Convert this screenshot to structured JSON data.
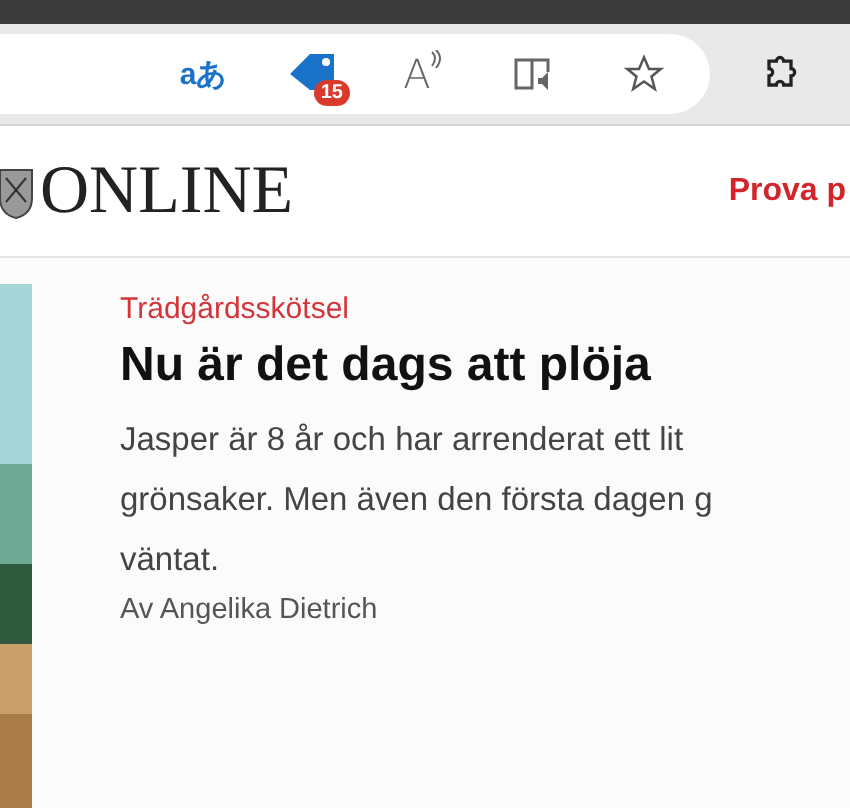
{
  "toolbar": {
    "translate_glyph": "aあ",
    "coupon_badge": "15",
    "read_aloud_glyph": "A"
  },
  "site_header": {
    "logo_text": "ONLINE",
    "cta": "Prova p"
  },
  "article": {
    "category": "Trädgårdsskötsel",
    "headline": "Nu är det dags att plöja",
    "summary_lines": [
      "Jasper är 8 år och har arrenderat ett lit",
      "grönsaker. Men även den första dagen g",
      "väntat."
    ],
    "byline": "Av Angelika Dietrich"
  }
}
